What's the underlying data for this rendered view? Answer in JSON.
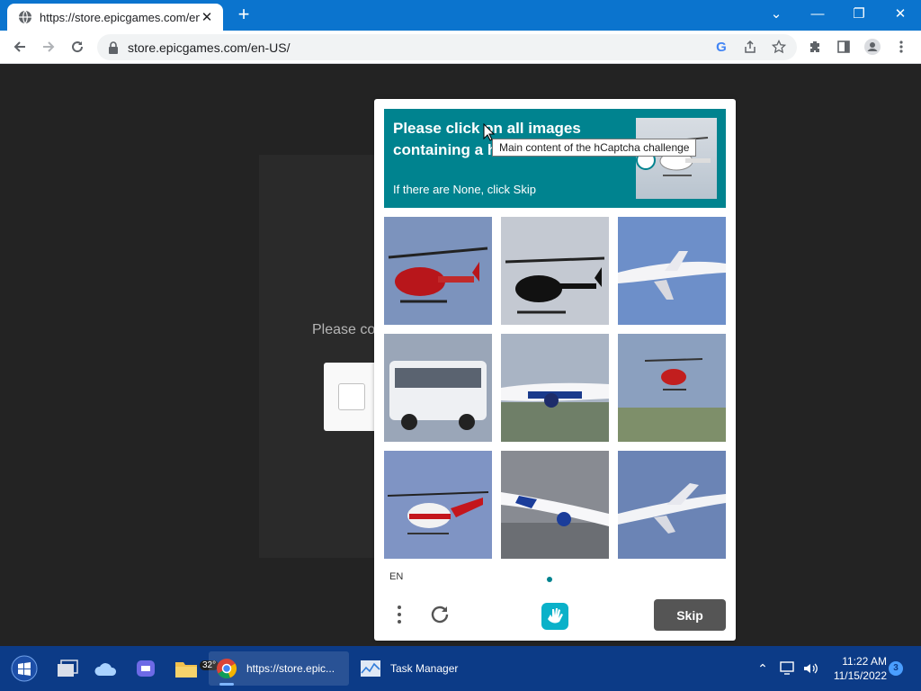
{
  "browser": {
    "tab_title": "https://store.epicgames.com/en-",
    "url": "store.epicgames.com/en-US/"
  },
  "page": {
    "partial_text": "Please co"
  },
  "captcha": {
    "prompt_title": "Please click on all images containing a h",
    "prompt_subtitle": "If there are None, click Skip",
    "tooltip": "Main content of the hCaptcha challenge",
    "language": "EN",
    "skip_label": "Skip",
    "accent_color": "#00838f",
    "tiles": [
      {
        "subject": "helicopter"
      },
      {
        "subject": "helicopter"
      },
      {
        "subject": "airplane"
      },
      {
        "subject": "bus"
      },
      {
        "subject": "airplane"
      },
      {
        "subject": "helicopter"
      },
      {
        "subject": "helicopter"
      },
      {
        "subject": "airplane"
      },
      {
        "subject": "airplane"
      }
    ]
  },
  "taskbar": {
    "weather_temp": "32°",
    "chrome_label": "https://store.epic...",
    "taskmgr_label": "Task Manager",
    "time": "11:22 AM",
    "date": "11/15/2022",
    "notification_count": "3"
  }
}
